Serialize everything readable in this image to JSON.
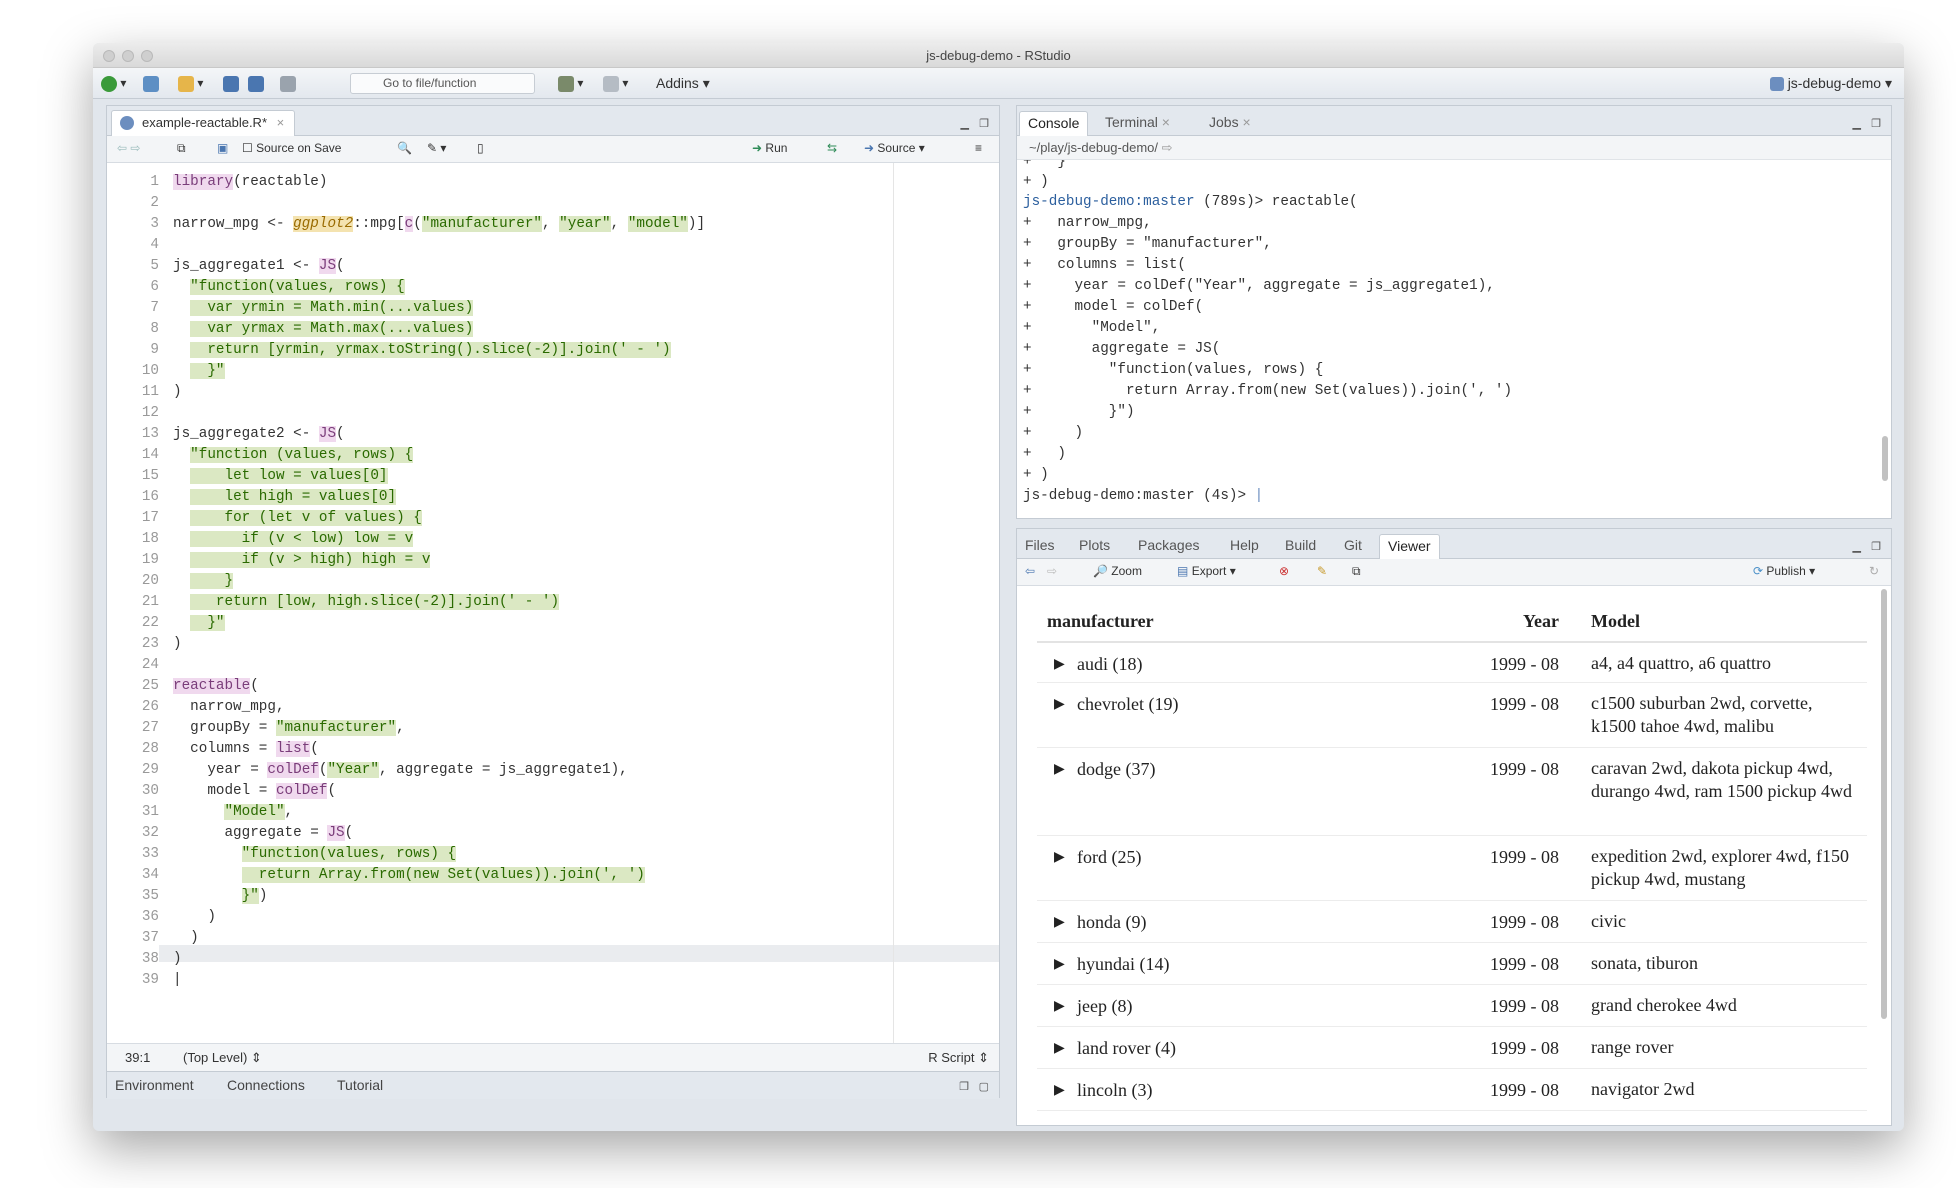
{
  "window": {
    "title": "js-debug-demo - RStudio"
  },
  "toolbar": {
    "goto_placeholder": "Go to file/function",
    "addins": "Addins",
    "project": "js-debug-demo"
  },
  "editor": {
    "tab": "example-reactable.R*",
    "source_on_save": "Source on Save",
    "run": "Run",
    "source": "Source",
    "status": {
      "position": "39:1",
      "scope": "(Top Level)",
      "type": "R Script"
    }
  },
  "env_tabs": [
    "Environment",
    "Connections",
    "Tutorial"
  ],
  "console": {
    "tabs": [
      "Console",
      "Terminal",
      "Jobs"
    ],
    "path": "~/play/js-debug-demo/"
  },
  "viewer": {
    "tabs": [
      "Files",
      "Plots",
      "Packages",
      "Help",
      "Build",
      "Git",
      "Viewer"
    ],
    "zoom": "Zoom",
    "export": "Export",
    "publish": "Publish",
    "headers": [
      "manufacturer",
      "Year",
      "Model"
    ],
    "rows": [
      {
        "m": "audi (18)",
        "y": "1999 - 08",
        "model": "a4, a4 quattro, a6 quattro"
      },
      {
        "m": "chevrolet (19)",
        "y": "1999 - 08",
        "model": "c1500 suburban 2wd, corvette, k1500 tahoe 4wd, malibu"
      },
      {
        "m": "dodge (37)",
        "y": "1999 - 08",
        "model": "caravan 2wd, dakota pickup 4wd, durango 4wd, ram 1500 pickup 4wd"
      },
      {
        "m": "ford (25)",
        "y": "1999 - 08",
        "model": "expedition 2wd, explorer 4wd, f150 pickup 4wd, mustang"
      },
      {
        "m": "honda (9)",
        "y": "1999 - 08",
        "model": "civic"
      },
      {
        "m": "hyundai (14)",
        "y": "1999 - 08",
        "model": "sonata, tiburon"
      },
      {
        "m": "jeep (8)",
        "y": "1999 - 08",
        "model": "grand cherokee 4wd"
      },
      {
        "m": "land rover (4)",
        "y": "1999 - 08",
        "model": "range rover"
      },
      {
        "m": "lincoln (3)",
        "y": "1999 - 08",
        "model": "navigator 2wd"
      }
    ]
  }
}
